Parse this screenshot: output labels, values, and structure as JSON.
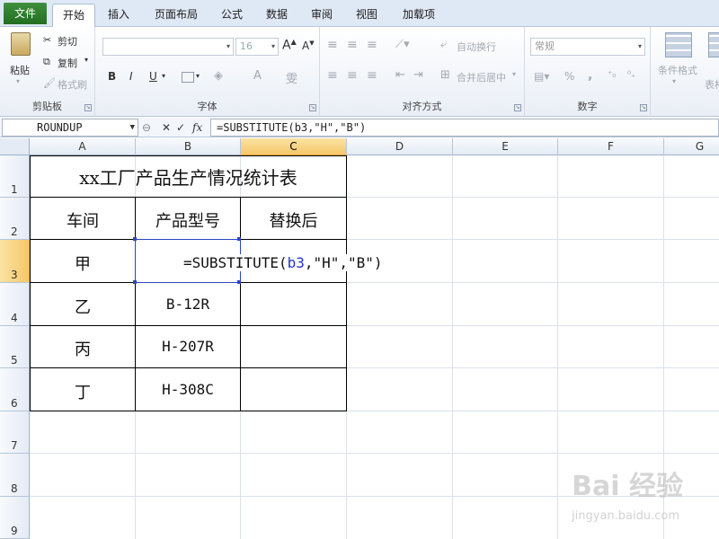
{
  "tabs": [
    {
      "label": "文件"
    },
    {
      "label": "开始"
    },
    {
      "label": "插入"
    },
    {
      "label": "页面布局"
    },
    {
      "label": "公式"
    },
    {
      "label": "数据"
    },
    {
      "label": "审阅"
    },
    {
      "label": "视图"
    },
    {
      "label": "加载项"
    }
  ],
  "ribbon": {
    "clipboard": {
      "paste": "粘贴",
      "cut": "剪切",
      "copy": "复制",
      "format_painter": "格式刷",
      "label": "剪贴板"
    },
    "font": {
      "size": "16",
      "label": "字体",
      "bold": "B",
      "italic": "I",
      "underline": "U"
    },
    "alignment": {
      "wrap_text": "自动换行",
      "merge_center": "合并后居中",
      "label": "对齐方式"
    },
    "number": {
      "format": "常规",
      "percent": "%",
      "comma": ",",
      "label": "数字"
    },
    "styles": {
      "conditional": "条件格式",
      "table_format": "表格"
    }
  },
  "formula_bar": {
    "name_box": "ROUNDUP",
    "cancel": "✕",
    "enter": "✓",
    "fx": "fx",
    "formula": "=SUBSTITUTE(b3,\"H\",\"B\")"
  },
  "columns": [
    "A",
    "B",
    "C",
    "D",
    "E",
    "F",
    "G"
  ],
  "rows": [
    "1",
    "2",
    "3",
    "4",
    "5",
    "6",
    "7",
    "8",
    "9"
  ],
  "sheet": {
    "title": "xx工厂产品生产情况统计表",
    "headers": {
      "workshop": "车间",
      "model": "产品型号",
      "replaced": "替换后"
    },
    "rows": [
      {
        "workshop": "甲",
        "model": ""
      },
      {
        "workshop": "乙",
        "model": "B-12R"
      },
      {
        "workshop": "丙",
        "model": "H-207R"
      },
      {
        "workshop": "丁",
        "model": "H-308C"
      }
    ],
    "editing": {
      "prefix": "=SUBSTITUTE(",
      "ref": "b3",
      "suffix": ",\"H\",\"B\")"
    }
  },
  "watermark": {
    "brand": "Bai 经验",
    "url": "jingyan.baidu.com"
  },
  "colors": {
    "selected_header": "#f5c76a",
    "file_tab": "#216e1f",
    "ref_highlight": "#2b45c9"
  }
}
